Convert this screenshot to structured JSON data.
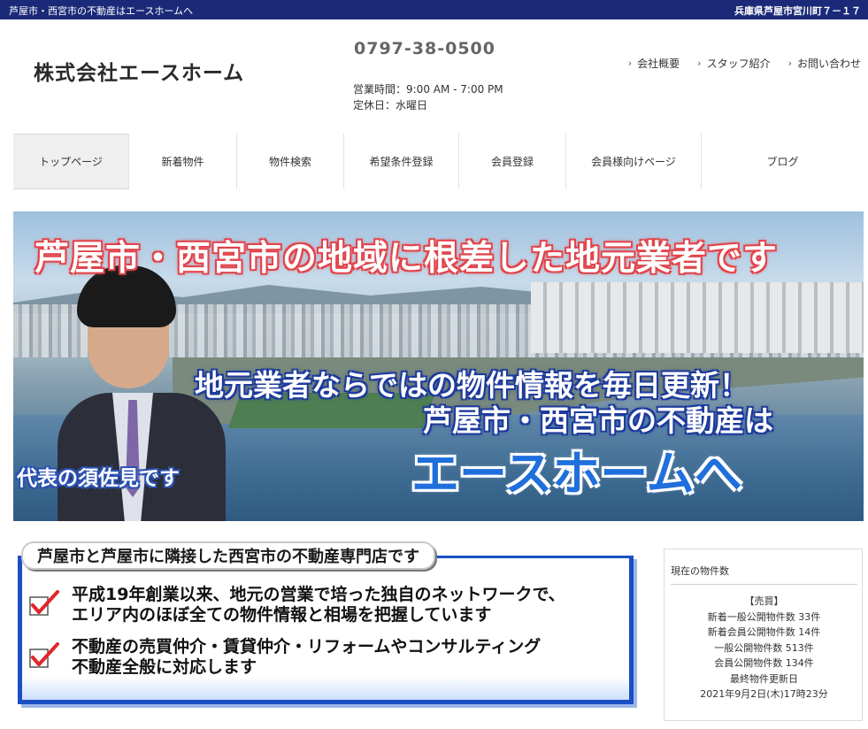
{
  "topbar": {
    "tagline": "芦屋市・西宮市の不動産はエースホームへ",
    "address": "兵庫県芦屋市宮川町７－１７"
  },
  "header": {
    "company": "株式会社エースホーム",
    "phone": "0797-38-0500",
    "hours": "営業時間：9:00 AM - 7:00 PM",
    "closed": "定休日：水曜日",
    "links": [
      {
        "label": "会社概要",
        "icon": "chevron-right-icon"
      },
      {
        "label": "スタッフ紹介",
        "icon": "chevron-right-icon"
      },
      {
        "label": "お問い合わせ",
        "icon": "chevron-right-icon"
      }
    ]
  },
  "nav": [
    {
      "label": "トップページ",
      "active": true
    },
    {
      "label": "新着物件"
    },
    {
      "label": "物件検索"
    },
    {
      "label": "希望条件登録"
    },
    {
      "label": "会員登録"
    },
    {
      "label": "会員様向けページ"
    },
    {
      "label": "ブログ"
    }
  ],
  "hero": {
    "headline": "芦屋市・西宮市の地域に根差した地元業者です",
    "line1": "地元業者ならではの物件情報を毎日更新！",
    "line2": "芦屋市・西宮市の不動産は",
    "brand": "エースホームへ",
    "rep": "代表の須佐見です"
  },
  "feature": {
    "title": "芦屋市と芦屋市に隣接した西宮市の不動産専門店です",
    "points": [
      {
        "line1": "平成19年創業以来、地元の営業で培った独自のネットワークで、",
        "line2": "エリア内のほぼ全ての物件情報と相場を把握しています",
        "icon": "checkmark-icon"
      },
      {
        "line1": "不動産の売買仲介・賃貸仲介・リフォームやコンサルティング",
        "line2": "不動産全般に対応します",
        "icon": "checkmark-icon"
      }
    ]
  },
  "side": {
    "title": "現在の物件数",
    "category": "【売買】",
    "new_public": "新着一般公開物件数 33件",
    "new_member": "新着会員公開物件数 14件",
    "public": "一般公開物件数 513件",
    "member": "会員公開物件数 134件",
    "updated_label": "最終物件更新日",
    "updated_value": "2021年9月2日(木)17時23分"
  },
  "colors": {
    "topbar": "#1b2a78",
    "accent_blue": "#1a4fc4",
    "headline_red": "#e8434a"
  }
}
